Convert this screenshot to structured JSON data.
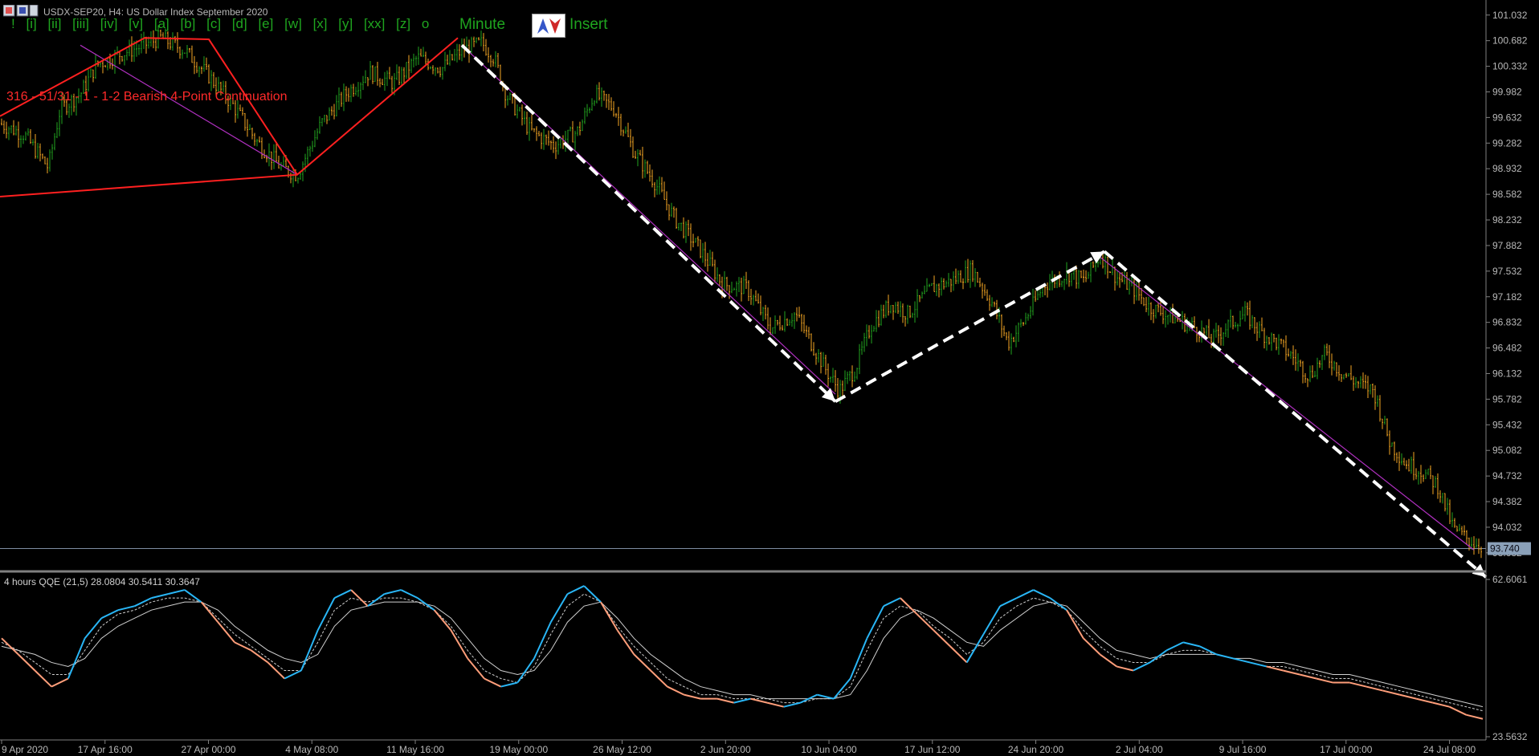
{
  "chart_header": {
    "symbol_title": "USDX-SEP20, H4:  US Dollar Index September 2020"
  },
  "elliott_toolbar": {
    "labels": [
      "!",
      "[i]",
      "[ii]",
      "[iii]",
      "[iv]",
      "[v]",
      "[a]",
      "[b]",
      "[c]",
      "[d]",
      "[e]",
      "[w]",
      "[x]",
      "[y]",
      "[xx]",
      "[z]",
      "o"
    ],
    "degree": "Minute",
    "insert_label": "Insert"
  },
  "pattern_label": "316 - 51/31 - 1 - 1-2 Bearish 4-Point Continuation",
  "indicator": {
    "label": "4 hours QQE (21,5) 28.0804 30.5411 30.3647"
  },
  "colors": {
    "background": "#000000",
    "up_bar": "#22a51f",
    "down_bar": "#f5a623",
    "pattern_line": "#ff2020",
    "channel_line": "#b030c0",
    "projection": "#ffffff",
    "qqe_rsi_up": "#29b6f6",
    "qqe_rsi_down": "#ff9e7a",
    "qqe_lines": "#d0d0d0",
    "axis_text": "#b8b8b8",
    "current_price_bg": "#8aa0b8"
  },
  "chart_data": [
    {
      "type": "ohlc",
      "title": "USDX-SEP20, H4:  US Dollar Index September 2020",
      "y_ticks": [
        "101.032",
        "100.682",
        "100.332",
        "99.982",
        "99.632",
        "99.282",
        "98.932",
        "98.582",
        "98.232",
        "97.882",
        "97.532",
        "97.182",
        "96.832",
        "96.482",
        "96.132",
        "95.782",
        "95.432",
        "95.082",
        "94.732",
        "94.382",
        "94.032",
        "93.682"
      ],
      "ylim": [
        93.45,
        101.15
      ],
      "current_price": "93.740",
      "current_price_value": 93.74,
      "x_ticks": [
        "9 Apr 2020",
        "17 Apr 16:00",
        "27 Apr 00:00",
        "4 May 08:00",
        "11 May 16:00",
        "19 May 00:00",
        "26 May 12:00",
        "2 Jun 20:00",
        "10 Jun 04:00",
        "17 Jun 12:00",
        "24 Jun 20:00",
        "2 Jul 04:00",
        "9 Jul 16:00",
        "17 Jul 00:00",
        "24 Jul 08:00"
      ],
      "price_path": [
        [
          0,
          99.55
        ],
        [
          30,
          99.4
        ],
        [
          60,
          98.95
        ],
        [
          75,
          99.75
        ],
        [
          100,
          99.95
        ],
        [
          120,
          100.35
        ],
        [
          150,
          100.5
        ],
        [
          175,
          100.6
        ],
        [
          200,
          100.72
        ],
        [
          230,
          100.55
        ],
        [
          260,
          100.2
        ],
        [
          290,
          99.8
        ],
        [
          320,
          99.3
        ],
        [
          350,
          98.95
        ],
        [
          370,
          98.85
        ],
        [
          400,
          99.55
        ],
        [
          430,
          99.95
        ],
        [
          460,
          100.25
        ],
        [
          490,
          100.1
        ],
        [
          520,
          100.45
        ],
        [
          550,
          100.3
        ],
        [
          575,
          100.55
        ],
        [
          600,
          100.65
        ],
        [
          615,
          100.45
        ],
        [
          630,
          99.95
        ],
        [
          660,
          99.45
        ],
        [
          690,
          99.25
        ],
        [
          720,
          99.45
        ],
        [
          740,
          99.95
        ],
        [
          765,
          99.75
        ],
        [
          790,
          99.15
        ],
        [
          815,
          98.75
        ],
        [
          840,
          98.25
        ],
        [
          870,
          97.85
        ],
        [
          900,
          97.35
        ],
        [
          930,
          97.3
        ],
        [
          960,
          96.75
        ],
        [
          990,
          96.95
        ],
        [
          1010,
          96.55
        ],
        [
          1030,
          96.15
        ],
        [
          1045,
          95.9
        ],
        [
          1065,
          96.2
        ],
        [
          1085,
          96.8
        ],
        [
          1110,
          97.1
        ],
        [
          1130,
          96.95
        ],
        [
          1160,
          97.3
        ],
        [
          1185,
          97.4
        ],
        [
          1210,
          97.55
        ],
        [
          1235,
          97.1
        ],
        [
          1255,
          96.55
        ],
        [
          1275,
          96.85
        ],
        [
          1300,
          97.35
        ],
        [
          1330,
          97.5
        ],
        [
          1350,
          97.4
        ],
        [
          1370,
          97.75
        ],
        [
          1390,
          97.45
        ],
        [
          1410,
          97.3
        ],
        [
          1430,
          97.05
        ],
        [
          1450,
          96.95
        ],
        [
          1470,
          96.85
        ],
        [
          1490,
          96.75
        ],
        [
          1510,
          96.6
        ],
        [
          1530,
          96.8
        ],
        [
          1550,
          96.95
        ],
        [
          1570,
          96.7
        ],
        [
          1590,
          96.55
        ],
        [
          1610,
          96.35
        ],
        [
          1630,
          96.1
        ],
        [
          1650,
          96.4
        ],
        [
          1670,
          96.15
        ],
        [
          1690,
          96.0
        ],
        [
          1710,
          95.9
        ],
        [
          1730,
          95.2
        ],
        [
          1750,
          94.9
        ],
        [
          1770,
          94.8
        ],
        [
          1790,
          94.6
        ],
        [
          1810,
          94.0
        ],
        [
          1830,
          93.85
        ],
        [
          1840,
          93.8
        ],
        [
          1850,
          93.74
        ]
      ],
      "elliott_wave_lines": [
        {
          "name": "pattern-upper",
          "points": [
            [
              0,
              99.65
            ],
            [
              180,
              100.72
            ],
            [
              260,
              100.7
            ],
            [
              370,
              98.85
            ],
            [
              570,
              100.72
            ]
          ]
        },
        {
          "name": "pattern-lower",
          "points": [
            [
              0,
              98.55
            ],
            [
              370,
              98.85
            ]
          ]
        }
      ],
      "channel_lines": [
        {
          "name": "channel-a",
          "points": [
            [
              100,
              100.62
            ],
            [
              370,
              98.85
            ]
          ]
        },
        {
          "name": "channel-b",
          "points": [
            [
              575,
              100.62
            ],
            [
              1040,
              95.85
            ]
          ]
        },
        {
          "name": "channel-c",
          "points": [
            [
              1370,
              97.72
            ],
            [
              1835,
              93.72
            ]
          ]
        }
      ],
      "projection_lines": [
        {
          "name": "projection-down-1",
          "points": [
            [
              575,
              100.62
            ],
            [
              1040,
              95.75
            ]
          ]
        },
        {
          "name": "projection-up",
          "points": [
            [
              1040,
              95.75
            ],
            [
              1375,
              97.8
            ]
          ]
        },
        {
          "name": "projection-down-2",
          "points": [
            [
              1375,
              97.8
            ],
            [
              1850,
              93.35
            ]
          ]
        }
      ]
    },
    {
      "type": "line",
      "title": "4 hours QQE (21,5) 28.0804 30.5411 30.3647",
      "y_ticks": [
        "62.6061",
        "23.5632"
      ],
      "ylim": [
        23.5632,
        62.6061
      ],
      "series": [
        {
          "name": "RSI",
          "values": [
            48,
            44,
            40,
            36,
            38,
            48,
            53,
            55,
            56,
            58,
            59,
            60,
            57,
            52,
            47,
            45,
            42,
            38,
            40,
            50,
            58,
            60,
            56,
            59,
            60,
            58,
            55,
            50,
            43,
            38,
            36,
            37,
            43,
            52,
            59,
            61,
            57,
            50,
            44,
            40,
            36,
            34,
            33,
            33,
            32,
            33,
            32,
            31,
            32,
            34,
            33,
            38,
            48,
            56,
            58,
            54,
            50,
            46,
            42,
            49,
            56,
            58,
            60,
            58,
            55,
            48,
            44,
            41,
            40,
            42,
            45,
            47,
            46,
            44,
            43,
            42,
            41,
            40,
            39,
            38,
            37,
            37,
            36,
            35,
            34,
            33,
            32,
            31,
            29,
            28
          ]
        },
        {
          "name": "Fast line",
          "values": [
            47,
            45,
            42,
            39,
            39,
            45,
            51,
            54,
            55,
            57,
            58,
            58,
            57,
            53,
            49,
            46,
            43,
            40,
            40,
            47,
            55,
            58,
            57,
            58,
            58,
            57,
            55,
            51,
            45,
            40,
            38,
            37,
            41,
            49,
            56,
            59,
            57,
            51,
            46,
            42,
            38,
            36,
            34,
            34,
            33,
            33,
            33,
            32,
            32,
            33,
            33,
            36,
            45,
            53,
            56,
            55,
            51,
            48,
            44,
            47,
            53,
            56,
            58,
            57,
            55,
            50,
            46,
            43,
            42,
            42,
            44,
            45,
            45,
            44,
            43,
            42,
            41,
            41,
            40,
            39,
            38,
            38,
            37,
            36,
            35,
            34,
            33,
            32,
            31,
            30
          ]
        },
        {
          "name": "Slow line",
          "values": [
            46,
            45,
            44,
            42,
            41,
            43,
            48,
            51,
            53,
            55,
            56,
            57,
            57,
            55,
            51,
            48,
            45,
            43,
            42,
            44,
            51,
            55,
            56,
            57,
            57,
            57,
            56,
            53,
            48,
            43,
            40,
            39,
            40,
            45,
            52,
            56,
            57,
            53,
            48,
            44,
            41,
            38,
            36,
            35,
            34,
            34,
            33,
            33,
            33,
            33,
            33,
            34,
            40,
            48,
            53,
            55,
            53,
            50,
            47,
            46,
            50,
            53,
            56,
            57,
            56,
            52,
            48,
            45,
            44,
            43,
            44,
            44,
            44,
            44,
            43,
            43,
            42,
            42,
            41,
            40,
            39,
            39,
            38,
            37,
            36,
            35,
            34,
            33,
            32,
            31
          ]
        }
      ]
    }
  ]
}
